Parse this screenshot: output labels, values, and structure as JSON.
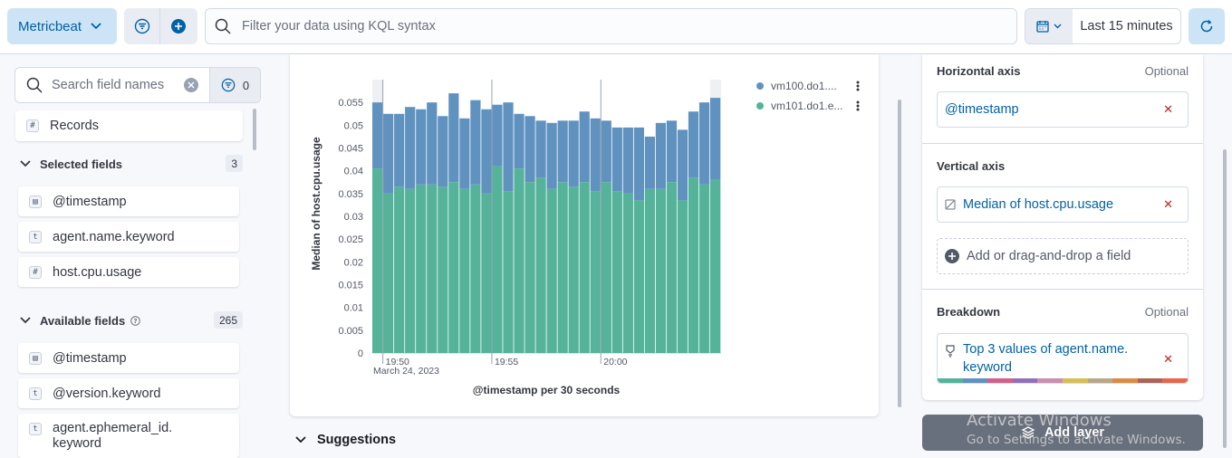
{
  "toolbar": {
    "data_view": "Metricbeat",
    "query_placeholder": "Filter your data using KQL syntax",
    "time_range": "Last 15 minutes"
  },
  "sidebar": {
    "search_placeholder": "Search field names",
    "filter_count": "0",
    "records_label": "Records",
    "selected_header": "Selected fields",
    "selected_count": "3",
    "selected_fields": [
      "@timestamp",
      "agent.name.keyword",
      "host.cpu.usage"
    ],
    "available_header": "Available fields",
    "available_count": "265",
    "available_fields": [
      "@timestamp",
      "@version.keyword",
      "agent.ephemeral_id.",
      "keyword"
    ]
  },
  "suggestions_label": "Suggestions",
  "config": {
    "horizontal_axis": "Horizontal axis",
    "horizontal_optional": "Optional",
    "horizontal_field": "@timestamp",
    "vertical_axis": "Vertical axis",
    "vertical_field": "Median of host.cpu.usage",
    "add_field": "Add or drag-and-drop a field",
    "breakdown": "Breakdown",
    "breakdown_optional": "Optional",
    "breakdown_field_1": "Top 3 values of agent.name.",
    "breakdown_field_2": "keyword",
    "palette": [
      "#54b399",
      "#6092c0",
      "#d36086",
      "#9170b8",
      "#ca8eae",
      "#d6bf57",
      "#b9a888",
      "#da8b45",
      "#aa6556",
      "#e7664c"
    ]
  },
  "add_layer_label": "Add layer",
  "watermark": {
    "line1": "Activate Windows",
    "line2": "Go to Settings to activate Windows."
  },
  "chart_data": {
    "type": "bar",
    "stacked": true,
    "xlabel": "@timestamp per 30 seconds",
    "ylabel": "Median of host.cpu.usage",
    "ylim": [
      0,
      0.06
    ],
    "yticks": [
      "0",
      "0.005",
      "0.01",
      "0.015",
      "0.02",
      "0.025",
      "0.03",
      "0.035",
      "0.04",
      "0.045",
      "0.05",
      "0.055"
    ],
    "x_ticks": [
      "19:50",
      "19:55",
      "20:00"
    ],
    "x_date": "March 24, 2023",
    "legend_position": "top-right",
    "series": [
      {
        "name": "vm101.do1.e...",
        "color": "#54b399",
        "values": [
          0.0405,
          0.035,
          0.0365,
          0.036,
          0.037,
          0.037,
          0.0365,
          0.0375,
          0.036,
          0.037,
          0.035,
          0.041,
          0.0355,
          0.0405,
          0.0375,
          0.0385,
          0.036,
          0.0375,
          0.0365,
          0.0375,
          0.0355,
          0.0375,
          0.0355,
          0.035,
          0.0335,
          0.036,
          0.036,
          0.0375,
          0.0335,
          0.0385,
          0.037,
          0.038
        ]
      },
      {
        "name": "vm100.do1....",
        "color": "#6092c0",
        "values": [
          0.0145,
          0.0175,
          0.016,
          0.018,
          0.0165,
          0.018,
          0.0155,
          0.0195,
          0.0155,
          0.0185,
          0.0185,
          0.0135,
          0.0195,
          0.012,
          0.0145,
          0.0125,
          0.0145,
          0.0135,
          0.0145,
          0.0155,
          0.016,
          0.0135,
          0.014,
          0.0145,
          0.016,
          0.0115,
          0.0145,
          0.0135,
          0.0155,
          0.0145,
          0.018,
          0.018
        ]
      }
    ]
  }
}
